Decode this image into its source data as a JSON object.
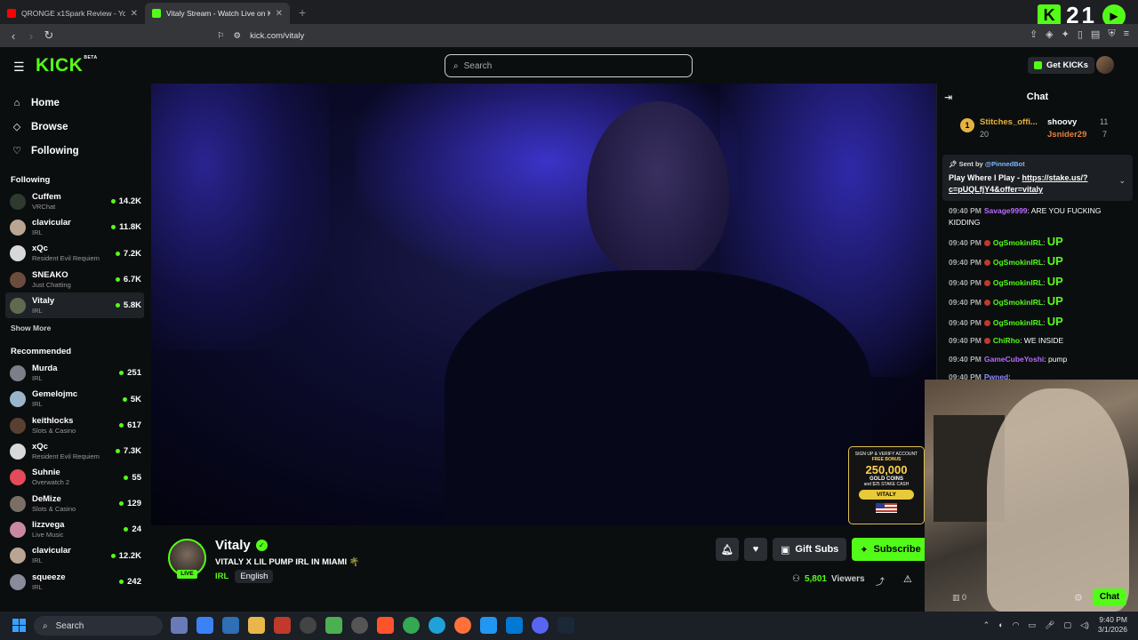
{
  "browser": {
    "tabs": [
      {
        "title": "QRONGE x1Spark Review - YouTube",
        "active": false,
        "favicon_color": "#ff0000"
      },
      {
        "title": "Vitaly Stream - Watch Live on Kick",
        "active": true,
        "favicon_color": "#53fc18"
      }
    ],
    "new_tab": "+",
    "url": "kick.com/vitaly",
    "counter": {
      "kick_glyph": "K",
      "number": "21",
      "play_glyph": "▶"
    }
  },
  "header": {
    "logo": "KICK",
    "logo_tag": "BETA",
    "search_placeholder": "Search",
    "get_kicks": "Get KICKs"
  },
  "sidebar": {
    "nav": [
      {
        "label": "Home",
        "icon": "home-icon"
      },
      {
        "label": "Browse",
        "icon": "browse-icon"
      },
      {
        "label": "Following",
        "icon": "heart-icon"
      }
    ],
    "following_title": "Following",
    "following": [
      {
        "name": "Cuffem",
        "category": "VRChat",
        "viewers": "14.2K",
        "avatar_color": "#2e3a2e"
      },
      {
        "name": "clavicular",
        "category": "IRL",
        "viewers": "11.8K",
        "avatar_color": "#b9a593"
      },
      {
        "name": "xQc",
        "category": "Resident Evil Requiem",
        "viewers": "7.2K",
        "avatar_color": "#d8d8d8"
      },
      {
        "name": "SNEAKO",
        "category": "Just Chatting",
        "viewers": "6.7K",
        "avatar_color": "#6a4d3c"
      },
      {
        "name": "Vitaly",
        "category": "IRL",
        "viewers": "5.8K",
        "avatar_color": "#5e6b4f"
      }
    ],
    "show_more": "Show More",
    "recommended_title": "Recommended",
    "recommended": [
      {
        "name": "Murda",
        "category": "IRL",
        "viewers": "251",
        "avatar_color": "#7c7f8a"
      },
      {
        "name": "Gemelojmc",
        "category": "IRL",
        "viewers": "5K",
        "avatar_color": "#9ab5c9"
      },
      {
        "name": "keithlocks",
        "category": "Slots & Casino",
        "viewers": "617",
        "avatar_color": "#5a4030"
      },
      {
        "name": "xQc",
        "category": "Resident Evil Requiem",
        "viewers": "7.3K",
        "avatar_color": "#d8d8d8"
      },
      {
        "name": "Suhnie",
        "category": "Overwatch 2",
        "viewers": "55",
        "avatar_color": "#e34a5a"
      },
      {
        "name": "DeMize",
        "category": "Slots & Casino",
        "viewers": "129",
        "avatar_color": "#7b6e64"
      },
      {
        "name": "lizzvega",
        "category": "Live Music",
        "viewers": "24",
        "avatar_color": "#c98aa0"
      },
      {
        "name": "clavicular",
        "category": "IRL",
        "viewers": "12.2K",
        "avatar_color": "#b9a593"
      },
      {
        "name": "squeeze",
        "category": "IRL",
        "viewers": "242",
        "avatar_color": "#8a8a9a"
      }
    ]
  },
  "video": {
    "promo": {
      "line1": "SIGN UP & VERIFY ACCOUNT",
      "line2": "FREE BONUS",
      "amount": "250,000",
      "gold": "GOLD COINS",
      "extra": "and $25 STAKE CASH",
      "button": "VITALY"
    }
  },
  "stream": {
    "name": "Vitaly",
    "live_badge": "LIVE",
    "title": "VITALY X LIL PUMP IRL IN MIAMI 🌴",
    "category": "IRL",
    "language": "English",
    "gift_subs": "Gift Subs",
    "subscribe": "Subscribe",
    "viewer_count": "5,801",
    "viewers_label": "Viewers"
  },
  "chat": {
    "title": "Chat",
    "leaderboard": [
      {
        "rank": "1",
        "name": "Stitches_offi...",
        "count": "20"
      },
      {
        "name": "shoovy",
        "count": "11"
      },
      {
        "name": "Jsnider29",
        "count": "7"
      }
    ],
    "pinned": {
      "prefix": "Sent by",
      "bot": "@PinnedBot",
      "text": "Play Where I Play - ",
      "link": "https://stake.us/?c=pUQLfjY4&offer=vitaly"
    },
    "messages": [
      {
        "time": "09:40 PM",
        "user": "Savage9999",
        "color": "#b86bff",
        "text": ": ARE YOU FUCKING KIDDING",
        "badge": false
      },
      {
        "time": "09:40 PM",
        "user": "OgSmokinIRL",
        "color": "#53fc18",
        "text": ": ",
        "up": "UP",
        "badge": true
      },
      {
        "time": "09:40 PM",
        "user": "OgSmokinIRL",
        "color": "#53fc18",
        "text": ": ",
        "up": "UP",
        "badge": true
      },
      {
        "time": "09:40 PM",
        "user": "OgSmokinIRL",
        "color": "#53fc18",
        "text": ": ",
        "up": "UP",
        "badge": true
      },
      {
        "time": "09:40 PM",
        "user": "OgSmokinIRL",
        "color": "#53fc18",
        "text": ": ",
        "up": "UP",
        "badge": true
      },
      {
        "time": "09:40 PM",
        "user": "OgSmokinIRL",
        "color": "#53fc18",
        "text": ": ",
        "up": "UP",
        "badge": true
      },
      {
        "time": "09:40 PM",
        "user": "ChiRho",
        "color": "#53fc18",
        "text": ": WE INSIDE",
        "badge": true
      },
      {
        "time": "09:40 PM",
        "user": "GameCubeYoshi",
        "color": "#b86bff",
        "text": ": pump",
        "badge": false
      },
      {
        "time": "09:40 PM",
        "user": "Pwned",
        "color": "#8a8aff",
        "text": ": ",
        "badge": false
      }
    ],
    "points": "0",
    "send": "Chat"
  },
  "taskbar": {
    "search": "Search",
    "time": "9:40 PM",
    "date": "3/1/2026"
  },
  "colors": {
    "accent": "#53fc18",
    "bg": "#0b0e0f"
  }
}
